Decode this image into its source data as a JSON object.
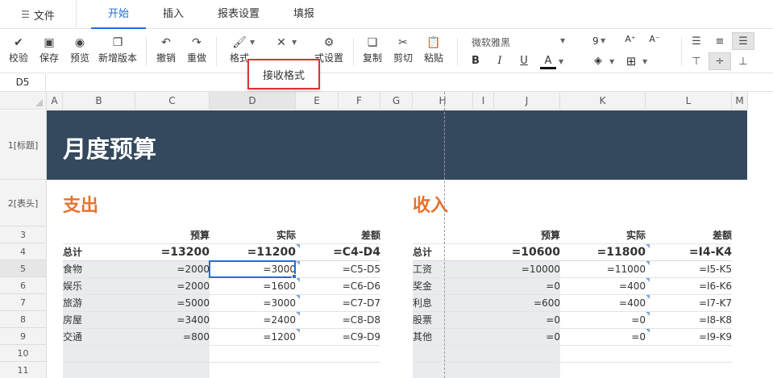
{
  "menu": {
    "file": "文件",
    "tabs": [
      "开始",
      "插入",
      "报表设置",
      "填报"
    ],
    "active_index": 0
  },
  "toolbar": {
    "check": "校验",
    "save": "保存",
    "preview": "预览",
    "new_version": "新增版本",
    "undo": "撤销",
    "redo": "重做",
    "format_painter": "格式",
    "clear_partial": "式设置",
    "copy": "复制",
    "cut": "剪切",
    "paste": "粘贴",
    "font_family": "微软雅黑",
    "font_size": "9",
    "bold": "B",
    "italic": "I",
    "underline": "U",
    "font_color": "A"
  },
  "popup": {
    "label": "接收格式"
  },
  "namebox": {
    "value": "D5"
  },
  "columns": [
    "A",
    "B",
    "C",
    "D",
    "E",
    "F",
    "G",
    "H",
    "I",
    "J",
    "K",
    "L",
    "M"
  ],
  "rows": [
    "1[标题]",
    "2[表头]",
    "3",
    "4",
    "5",
    "6",
    "7",
    "8",
    "9",
    "10",
    "11"
  ],
  "sheet": {
    "title": "月度预算",
    "expense": {
      "heading": "支出",
      "col_budget": "预算",
      "col_actual": "实际",
      "col_diff": "差额",
      "total_label": "总计",
      "total_budget": "=13200",
      "total_actual": "=11200",
      "total_diff": "=C4-D4",
      "items": [
        {
          "name": "食物",
          "budget": "=2000",
          "actual": "=3000",
          "diff": "=C5-D5"
        },
        {
          "name": "娱乐",
          "budget": "=2000",
          "actual": "=1600",
          "diff": "=C6-D6"
        },
        {
          "name": "旅游",
          "budget": "=5000",
          "actual": "=3000",
          "diff": "=C7-D7"
        },
        {
          "name": "房屋",
          "budget": "=3400",
          "actual": "=2400",
          "diff": "=C8-D8"
        },
        {
          "name": "交通",
          "budget": "=800",
          "actual": "=1200",
          "diff": "=C9-D9"
        }
      ]
    },
    "income": {
      "heading": "收入",
      "col_budget": "预算",
      "col_actual": "实际",
      "col_diff": "差额",
      "total_label": "总计",
      "total_budget": "=10600",
      "total_actual": "=11800",
      "total_diff": "=I4-K4",
      "items": [
        {
          "name": "工资",
          "budget": "=10000",
          "actual": "=11000",
          "diff": "=I5-K5"
        },
        {
          "name": "奖金",
          "budget": "=0",
          "actual": "=400",
          "diff": "=I6-K6"
        },
        {
          "name": "利息",
          "budget": "=600",
          "actual": "=400",
          "diff": "=I7-K7"
        },
        {
          "name": "股票",
          "budget": "=0",
          "actual": "=0",
          "diff": "=I8-K8"
        },
        {
          "name": "其他",
          "budget": "=0",
          "actual": "=0",
          "diff": "=I9-K9"
        }
      ]
    }
  },
  "colors": {
    "accent": "#1e6fd9",
    "title_bg": "#34495e",
    "heading": "#e8712b",
    "popup_border": "#e03030"
  }
}
